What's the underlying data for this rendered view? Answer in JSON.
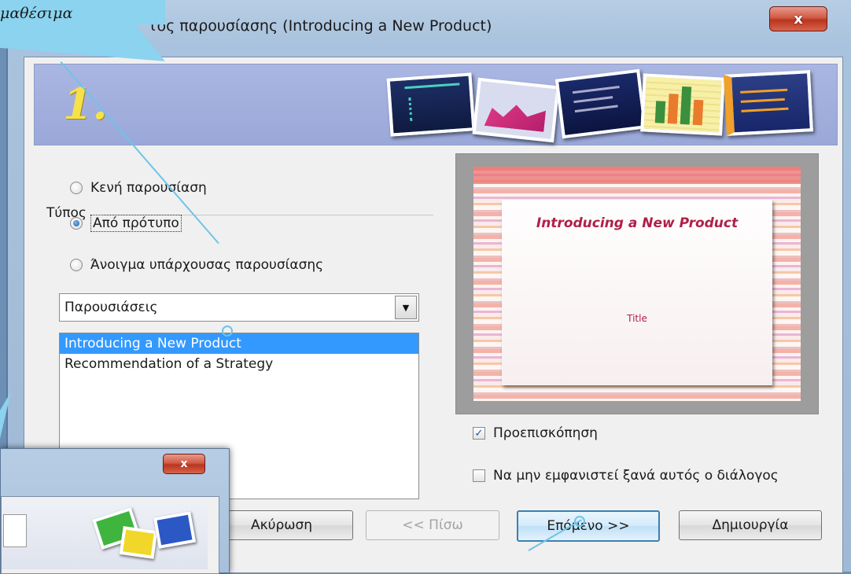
{
  "window": {
    "title": "τος παρουσίασης (Introducing a New Product)",
    "close_label": "x"
  },
  "banner": {
    "step": "1."
  },
  "type_group": {
    "label": "Τύπος",
    "options": [
      {
        "label": "Κενή παρουσίαση",
        "selected": false
      },
      {
        "label": "Από πρότυπο",
        "selected": true
      },
      {
        "label": "Άνοιγμα υπάρχουσας παρουσίασης",
        "selected": false
      }
    ]
  },
  "category_select": {
    "value": "Παρουσιάσεις"
  },
  "template_list": {
    "items": [
      {
        "label": "Introducing a New Product",
        "selected": true
      },
      {
        "label": "Recommendation of a Strategy",
        "selected": false
      }
    ]
  },
  "preview": {
    "slide_title": "Introducing a New Product",
    "slide_subtitle": "Title"
  },
  "options": {
    "preview_label": "Προεπισκόπηση",
    "preview_checked": true,
    "dont_show_label": "Να μην εμφανιστεί ξανά αυτός ο διάλογος",
    "dont_show_checked": false
  },
  "buttons": {
    "cancel": "Ακύρωση",
    "back": "<< Πίσω",
    "next": "Επόμενο >>",
    "create": "Δημιουργία"
  },
  "callout": {
    "text": "μαθέσιμα"
  },
  "mini_dialog": {
    "close_label": "x"
  },
  "colors": {
    "selection": "#3399ff",
    "banner": "#9aa8d9",
    "callout": "#8bd3ef",
    "step_number": "#f7e14b"
  }
}
